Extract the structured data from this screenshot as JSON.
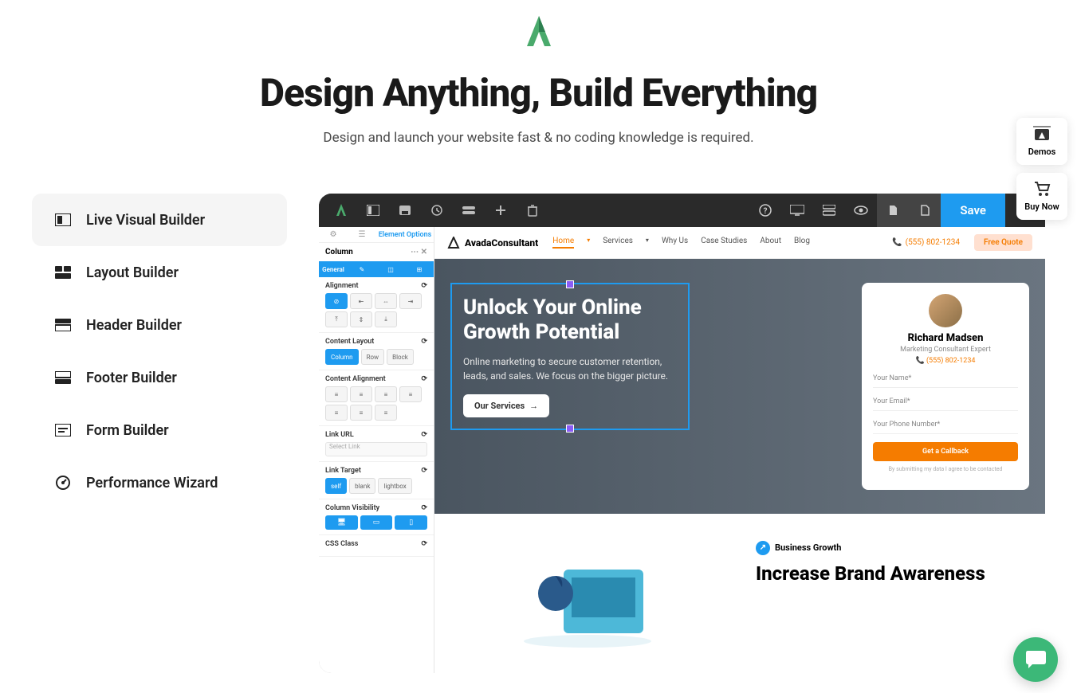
{
  "hero": {
    "title": "Design Anything, Build Everything",
    "subtitle": "Design and launch your website fast & no coding knowledge is required."
  },
  "tabs": [
    {
      "label": "Live Visual Builder",
      "active": true
    },
    {
      "label": "Layout Builder",
      "active": false
    },
    {
      "label": "Header Builder",
      "active": false
    },
    {
      "label": "Footer Builder",
      "active": false
    },
    {
      "label": "Form Builder",
      "active": false
    },
    {
      "label": "Performance Wizard",
      "active": false
    }
  ],
  "topbar": {
    "save": "Save"
  },
  "sidebar": {
    "element_options": "Element Options",
    "column": "Column",
    "general": "General",
    "alignment": "Alignment",
    "content_layout": "Content Layout",
    "layout_options": [
      "Column",
      "Row",
      "Block"
    ],
    "content_alignment": "Content Alignment",
    "link_url": "Link URL",
    "link_placeholder": "Select Link",
    "link_target": "Link Target",
    "target_options": [
      "self",
      "blank",
      "lightbox"
    ],
    "column_visibility": "Column Visibility",
    "css_class": "CSS Class"
  },
  "site": {
    "brand": "AvadaConsultant",
    "nav": [
      "Home",
      "Services",
      "Why Us",
      "Case Studies",
      "About",
      "Blog"
    ],
    "phone": "(555) 802-1234",
    "quote": "Free Quote"
  },
  "canvas_hero": {
    "title": "Unlock Your Online Growth Potential",
    "body": "Online marketing to secure customer retention, leads, and sales. We focus on the bigger picture.",
    "cta": "Our Services"
  },
  "card": {
    "name": "Richard Madsen",
    "role": "Marketing Consultant Expert",
    "phone": "(555) 802-1234",
    "fields": [
      "Your Name*",
      "Your Email*",
      "Your Phone Number*"
    ],
    "submit": "Get a Callback",
    "note": "By submitting my data I agree to be contacted"
  },
  "lower": {
    "badge": "Business Growth",
    "title": "Increase Brand Awareness"
  },
  "floats": {
    "demos": "Demos",
    "buy": "Buy Now"
  }
}
